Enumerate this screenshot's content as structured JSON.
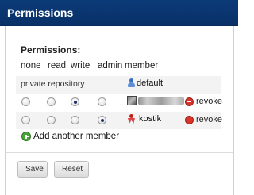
{
  "window": {
    "title": "Permissions"
  },
  "section": {
    "title": "Permissions:"
  },
  "columns": [
    "none",
    "read",
    "write",
    "admin",
    "member"
  ],
  "private_row": {
    "label": "private repository",
    "member": "default"
  },
  "members": [
    {
      "name": "",
      "selected_permission": "write",
      "action": "revoke"
    },
    {
      "name": "kostik",
      "selected_permission": "admin",
      "action": "revoke"
    }
  ],
  "add_member": {
    "label": "Add another member"
  },
  "buttons": {
    "save": "Save",
    "reset": "Reset"
  },
  "colors": {
    "title_bar": "#0b3a78",
    "revoke": "#d9342b",
    "add": "#4aa43a"
  }
}
